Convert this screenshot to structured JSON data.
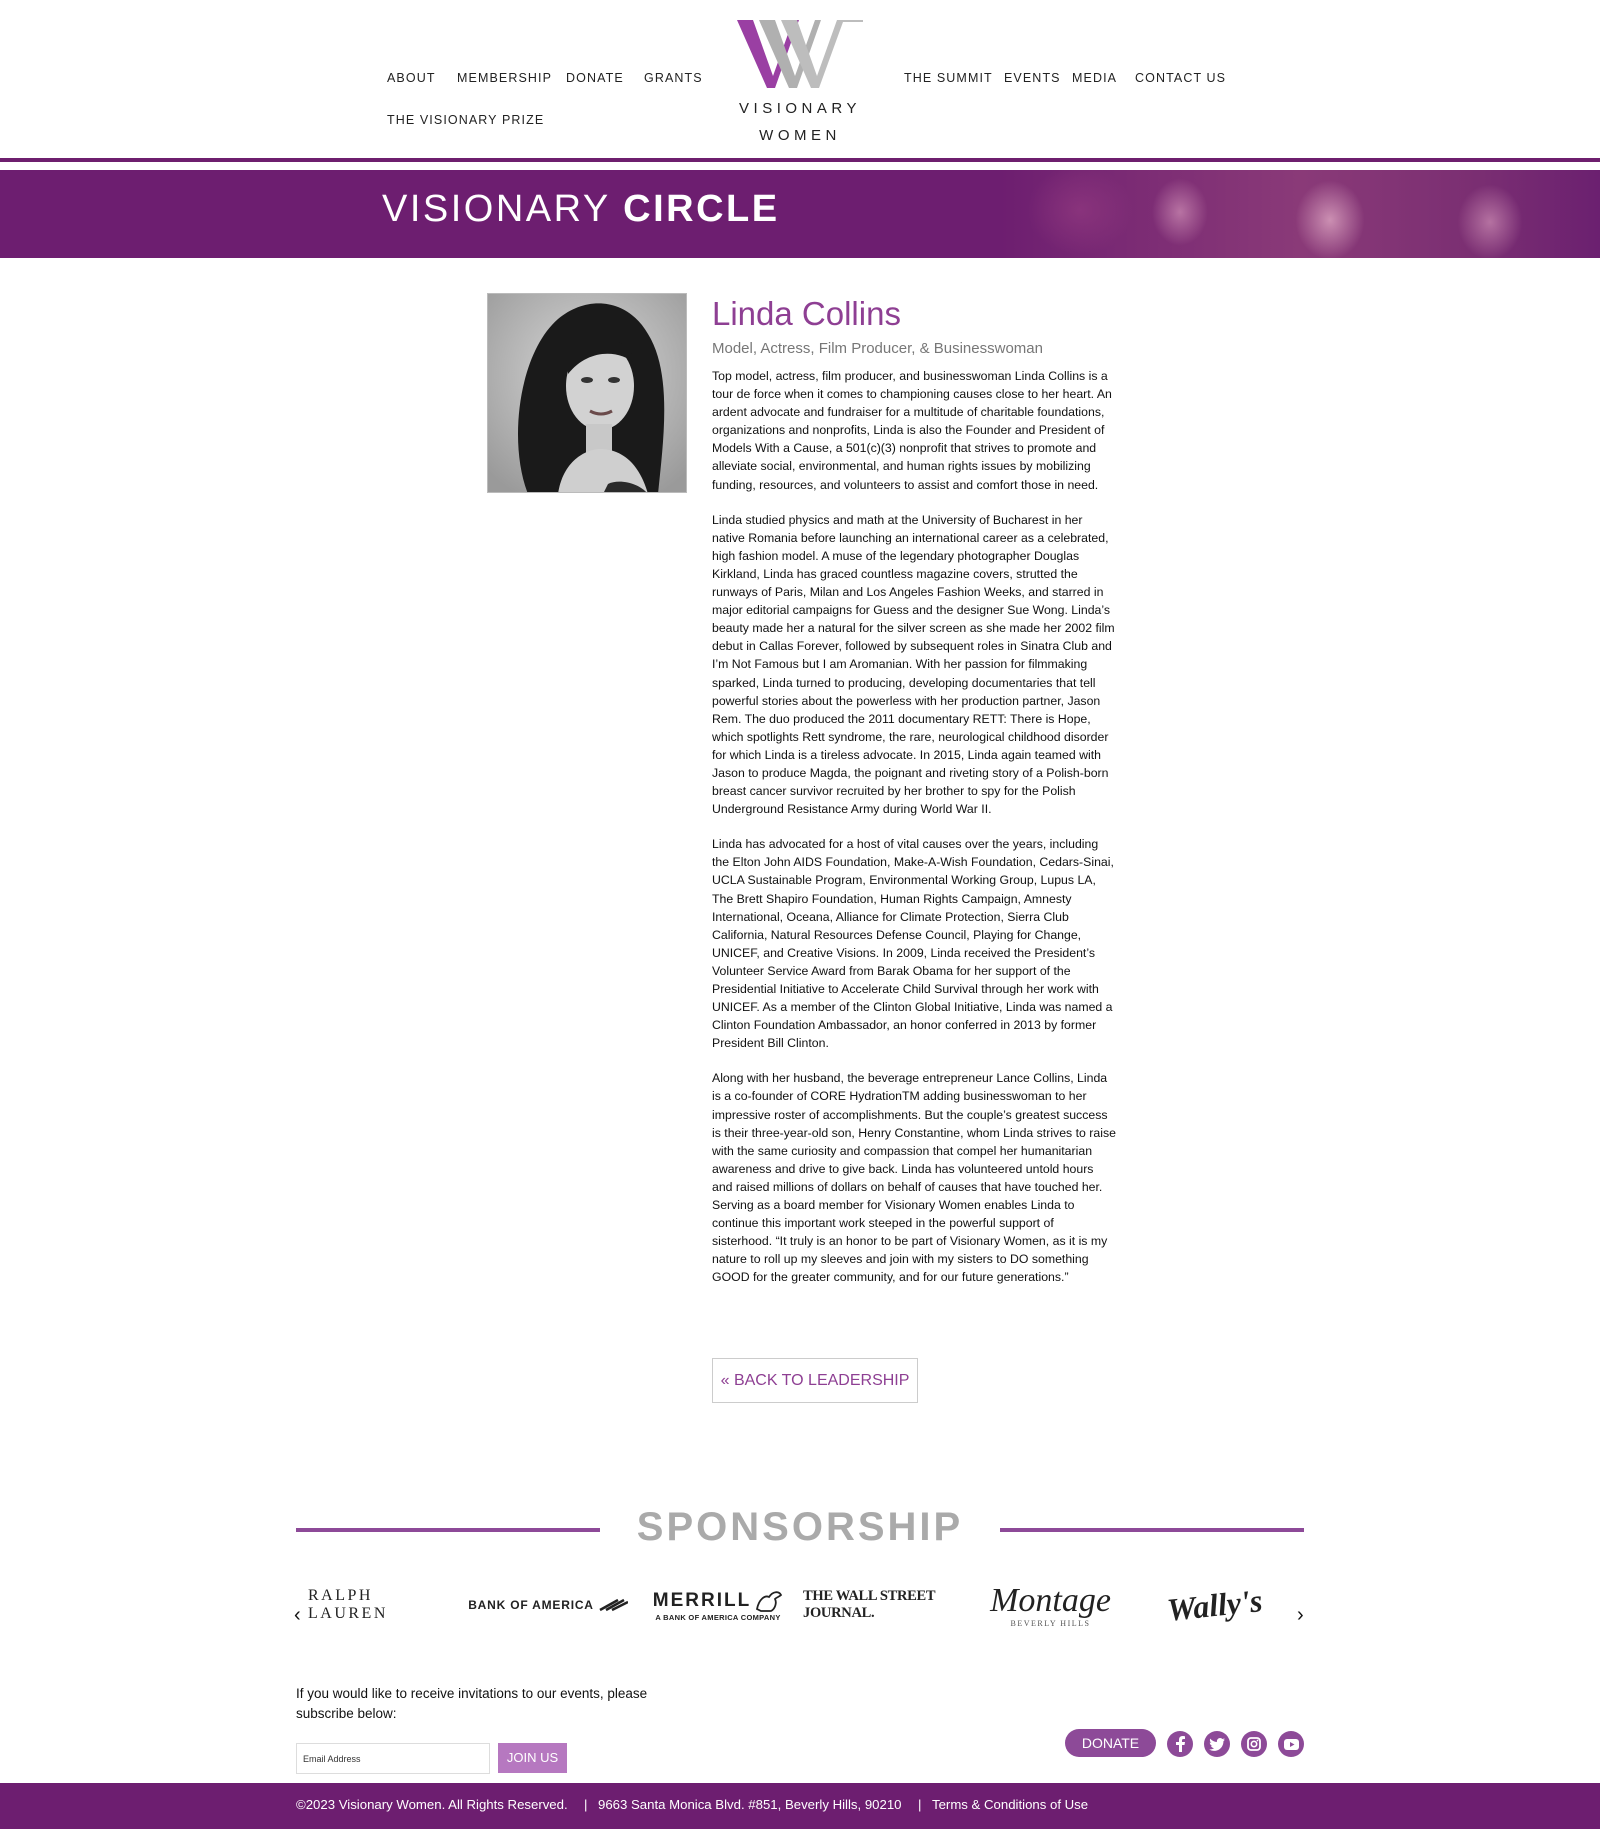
{
  "nav": {
    "left": [
      "ABOUT",
      "MEMBERSHIP",
      "DONATE",
      "GRANTS",
      "THE VISIONARY PRIZE"
    ],
    "right": [
      "THE SUMMIT",
      "EVENTS",
      "MEDIA",
      "CONTACT US"
    ]
  },
  "logo": {
    "line1": "VISIONARY",
    "line2": "WOMEN"
  },
  "banner": {
    "title_light": "VISIONARY ",
    "title_bold": "CIRCLE"
  },
  "profile": {
    "name": "Linda Collins",
    "role": "Model, Actress, Film Producer, & Businesswoman",
    "bio": [
      "Top model, actress, film producer, and businesswoman Linda Collins is a tour de force when it comes to championing causes close to her heart. An ardent advocate and fundraiser for a multitude of charitable foundations, organizations and nonprofits, Linda is also the Founder and President of Models With a Cause, a 501(c)(3) nonprofit that strives to promote and alleviate social, environmental, and human rights issues by mobilizing funding, resources, and volunteers to assist and comfort those in need.",
      "Linda studied physics and math at the University of Bucharest in her native Romania before launching an international career as a celebrated, high fashion model. A muse of the legendary photographer Douglas Kirkland, Linda has graced countless magazine covers, strutted the runways of Paris, Milan and Los Angeles Fashion Weeks, and starred in major editorial campaigns for Guess and the designer Sue Wong. Linda’s beauty made her a natural for the silver screen as she made her 2002 film debut in Callas Forever, followed by subsequent roles in Sinatra Club and I’m Not Famous but I am Aromanian. With her passion for filmmaking sparked, Linda turned to producing, developing documentaries that tell powerful stories about the powerless with her production partner, Jason Rem. The duo produced the 2011 documentary RETT: There is Hope, which spotlights Rett syndrome, the rare, neurological childhood disorder for which Linda is a tireless advocate. In 2015, Linda again teamed with Jason to produce Magda, the poignant and riveting story of a Polish-born breast cancer survivor recruited by her brother to spy for the Polish Underground Resistance Army during World War II.",
      "Linda has advocated for a host of vital causes over the years, including the Elton John AIDS Foundation, Make-A-Wish Foundation, Cedars-Sinai, UCLA Sustainable Program, Environmental Working Group, Lupus LA, The Brett Shapiro Foundation, Human Rights Campaign, Amnesty International, Oceana, Alliance for Climate Protection, Sierra Club California, Natural Resources Defense Council, Playing for Change, UNICEF, and Creative Visions. In 2009, Linda received the President’s Volunteer Service Award from Barak Obama for her support of the Presidential Initiative to Accelerate Child Survival through her work with UNICEF. As a member of the Clinton Global Initiative, Linda was named a Clinton Foundation Ambassador, an honor conferred in 2013 by former President Bill Clinton.",
      "Along with her husband, the beverage entrepreneur Lance Collins, Linda is a co-founder of CORE HydrationTM adding businesswoman to her impressive roster of accomplishments. But the couple’s greatest success is their three-year-old son, Henry Constantine, whom Linda strives to raise with the same curiosity and compassion that compel her humanitarian awareness and drive to give back. Linda has volunteered untold hours and raised millions of dollars on behalf of causes that have touched her. Serving as a board member for Visionary Women enables Linda to continue this important work steeped in the powerful support of sisterhood. “It truly is an honor to be part of Visionary Women, as it is my nature to roll up my sleeves and join with my sisters to DO something GOOD for the greater community, and for our future generations.”"
    ],
    "back_label": "« BACK TO LEADERSHIP"
  },
  "sponsorship": {
    "title": "SPONSORSHIP",
    "sponsors": [
      "RALPH LAUREN",
      "BANK OF AMERICA",
      "MERRILL",
      "A BANK OF AMERICA COMPANY",
      "THE WALL STREET JOURNAL.",
      "Montage",
      "BEVERLY HILLS",
      "Wally's"
    ],
    "prev": "‹",
    "next": "›"
  },
  "subscribe": {
    "text": "If you would like to receive invitations to our events, please subscribe below:",
    "placeholder": "Email Address",
    "join_label": "JOIN US"
  },
  "donate_label": "DONATE",
  "social_icons": [
    "facebook-icon",
    "twitter-icon",
    "instagram-icon",
    "youtube-icon"
  ],
  "footer": {
    "copyright": "©2023 Visionary Women. All Rights Reserved.",
    "sep1": "|",
    "address": "9663 Santa Monica Blvd. #851, Beverly Hills, 90210",
    "sep2": "|",
    "terms": "Terms & Conditions of Use"
  },
  "colors": {
    "brand_purple": "#6d1e70",
    "accent_purple": "#8e3f93",
    "light_purple": "#b678c0"
  }
}
